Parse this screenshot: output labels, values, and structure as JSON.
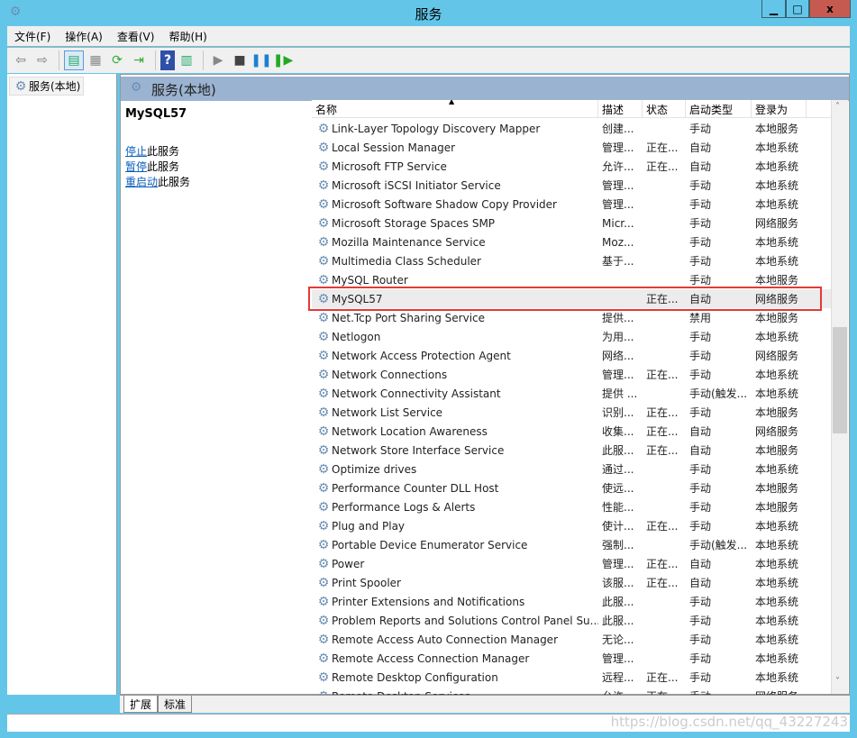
{
  "window": {
    "title": "服务",
    "minimize": "▁",
    "maximize": "□",
    "close": "x"
  },
  "menu": [
    "文件(F)",
    "操作(A)",
    "查看(V)",
    "帮助(H)"
  ],
  "toolbar": [
    "back-icon",
    "forward-icon",
    "show-hide-tree-icon",
    "properties-icon",
    "refresh-icon",
    "export-icon",
    "help-icon",
    "console-icon",
    "start-icon",
    "stop-icon",
    "pause-icon",
    "resume-icon"
  ],
  "tree": {
    "root": "服务(本地)"
  },
  "panel": {
    "title": "服务(本地)",
    "selected": "MySQL57",
    "actions": [
      {
        "link": "停止",
        "rest": "此服务"
      },
      {
        "link": "暂停",
        "rest": "此服务"
      },
      {
        "link": "重启动",
        "rest": "此服务"
      }
    ]
  },
  "columns": [
    "名称",
    "描述",
    "状态",
    "启动类型",
    "登录为"
  ],
  "rows": [
    [
      "Link-Layer Topology Discovery Mapper",
      "创建...",
      "",
      "手动",
      "本地服务"
    ],
    [
      "Local Session Manager",
      "管理...",
      "正在...",
      "自动",
      "本地系统"
    ],
    [
      "Microsoft FTP Service",
      "允许...",
      "正在...",
      "自动",
      "本地系统"
    ],
    [
      "Microsoft iSCSI Initiator Service",
      "管理...",
      "",
      "手动",
      "本地系统"
    ],
    [
      "Microsoft Software Shadow Copy Provider",
      "管理...",
      "",
      "手动",
      "本地系统"
    ],
    [
      "Microsoft Storage Spaces SMP",
      "Micr...",
      "",
      "手动",
      "网络服务"
    ],
    [
      "Mozilla Maintenance Service",
      "Moz...",
      "",
      "手动",
      "本地系统"
    ],
    [
      "Multimedia Class Scheduler",
      "基于...",
      "",
      "手动",
      "本地系统"
    ],
    [
      "MySQL Router",
      "",
      "",
      "手动",
      "本地服务"
    ],
    [
      "MySQL57",
      "",
      "正在...",
      "自动",
      "网络服务"
    ],
    [
      "Net.Tcp Port Sharing Service",
      "提供...",
      "",
      "禁用",
      "本地服务"
    ],
    [
      "Netlogon",
      "为用...",
      "",
      "手动",
      "本地系统"
    ],
    [
      "Network Access Protection Agent",
      "网络...",
      "",
      "手动",
      "网络服务"
    ],
    [
      "Network Connections",
      "管理...",
      "正在...",
      "手动",
      "本地系统"
    ],
    [
      "Network Connectivity Assistant",
      "提供 ...",
      "",
      "手动(触发...",
      "本地系统"
    ],
    [
      "Network List Service",
      "识别...",
      "正在...",
      "手动",
      "本地服务"
    ],
    [
      "Network Location Awareness",
      "收集...",
      "正在...",
      "自动",
      "网络服务"
    ],
    [
      "Network Store Interface Service",
      "此服...",
      "正在...",
      "自动",
      "本地服务"
    ],
    [
      "Optimize drives",
      "通过...",
      "",
      "手动",
      "本地系统"
    ],
    [
      "Performance Counter DLL Host",
      "使远...",
      "",
      "手动",
      "本地服务"
    ],
    [
      "Performance Logs & Alerts",
      "性能...",
      "",
      "手动",
      "本地服务"
    ],
    [
      "Plug and Play",
      "使计...",
      "正在...",
      "手动",
      "本地系统"
    ],
    [
      "Portable Device Enumerator Service",
      "强制...",
      "",
      "手动(触发...",
      "本地系统"
    ],
    [
      "Power",
      "管理...",
      "正在...",
      "自动",
      "本地系统"
    ],
    [
      "Print Spooler",
      "该服...",
      "正在...",
      "自动",
      "本地系统"
    ],
    [
      "Printer Extensions and Notifications",
      "此服...",
      "",
      "手动",
      "本地系统"
    ],
    [
      "Problem Reports and Solutions Control Panel Su...",
      "此服...",
      "",
      "手动",
      "本地系统"
    ],
    [
      "Remote Access Auto Connection Manager",
      "无论...",
      "",
      "手动",
      "本地系统"
    ],
    [
      "Remote Access Connection Manager",
      "管理...",
      "",
      "手动",
      "本地系统"
    ],
    [
      "Remote Desktop Configuration",
      "远程...",
      "正在...",
      "手动",
      "本地系统"
    ],
    [
      "Remote Desktop Services",
      "允许...",
      "正在...",
      "手动",
      "网络服务"
    ]
  ],
  "selected_index": 9,
  "tabs": [
    "扩展",
    "标准"
  ],
  "watermark": "https://blog.csdn.net/qq_43227243",
  "colors": {
    "titlebar": "#63c6e9",
    "close": "#c75a50",
    "highlight": "#e53935",
    "link": "#0b5fbd"
  }
}
